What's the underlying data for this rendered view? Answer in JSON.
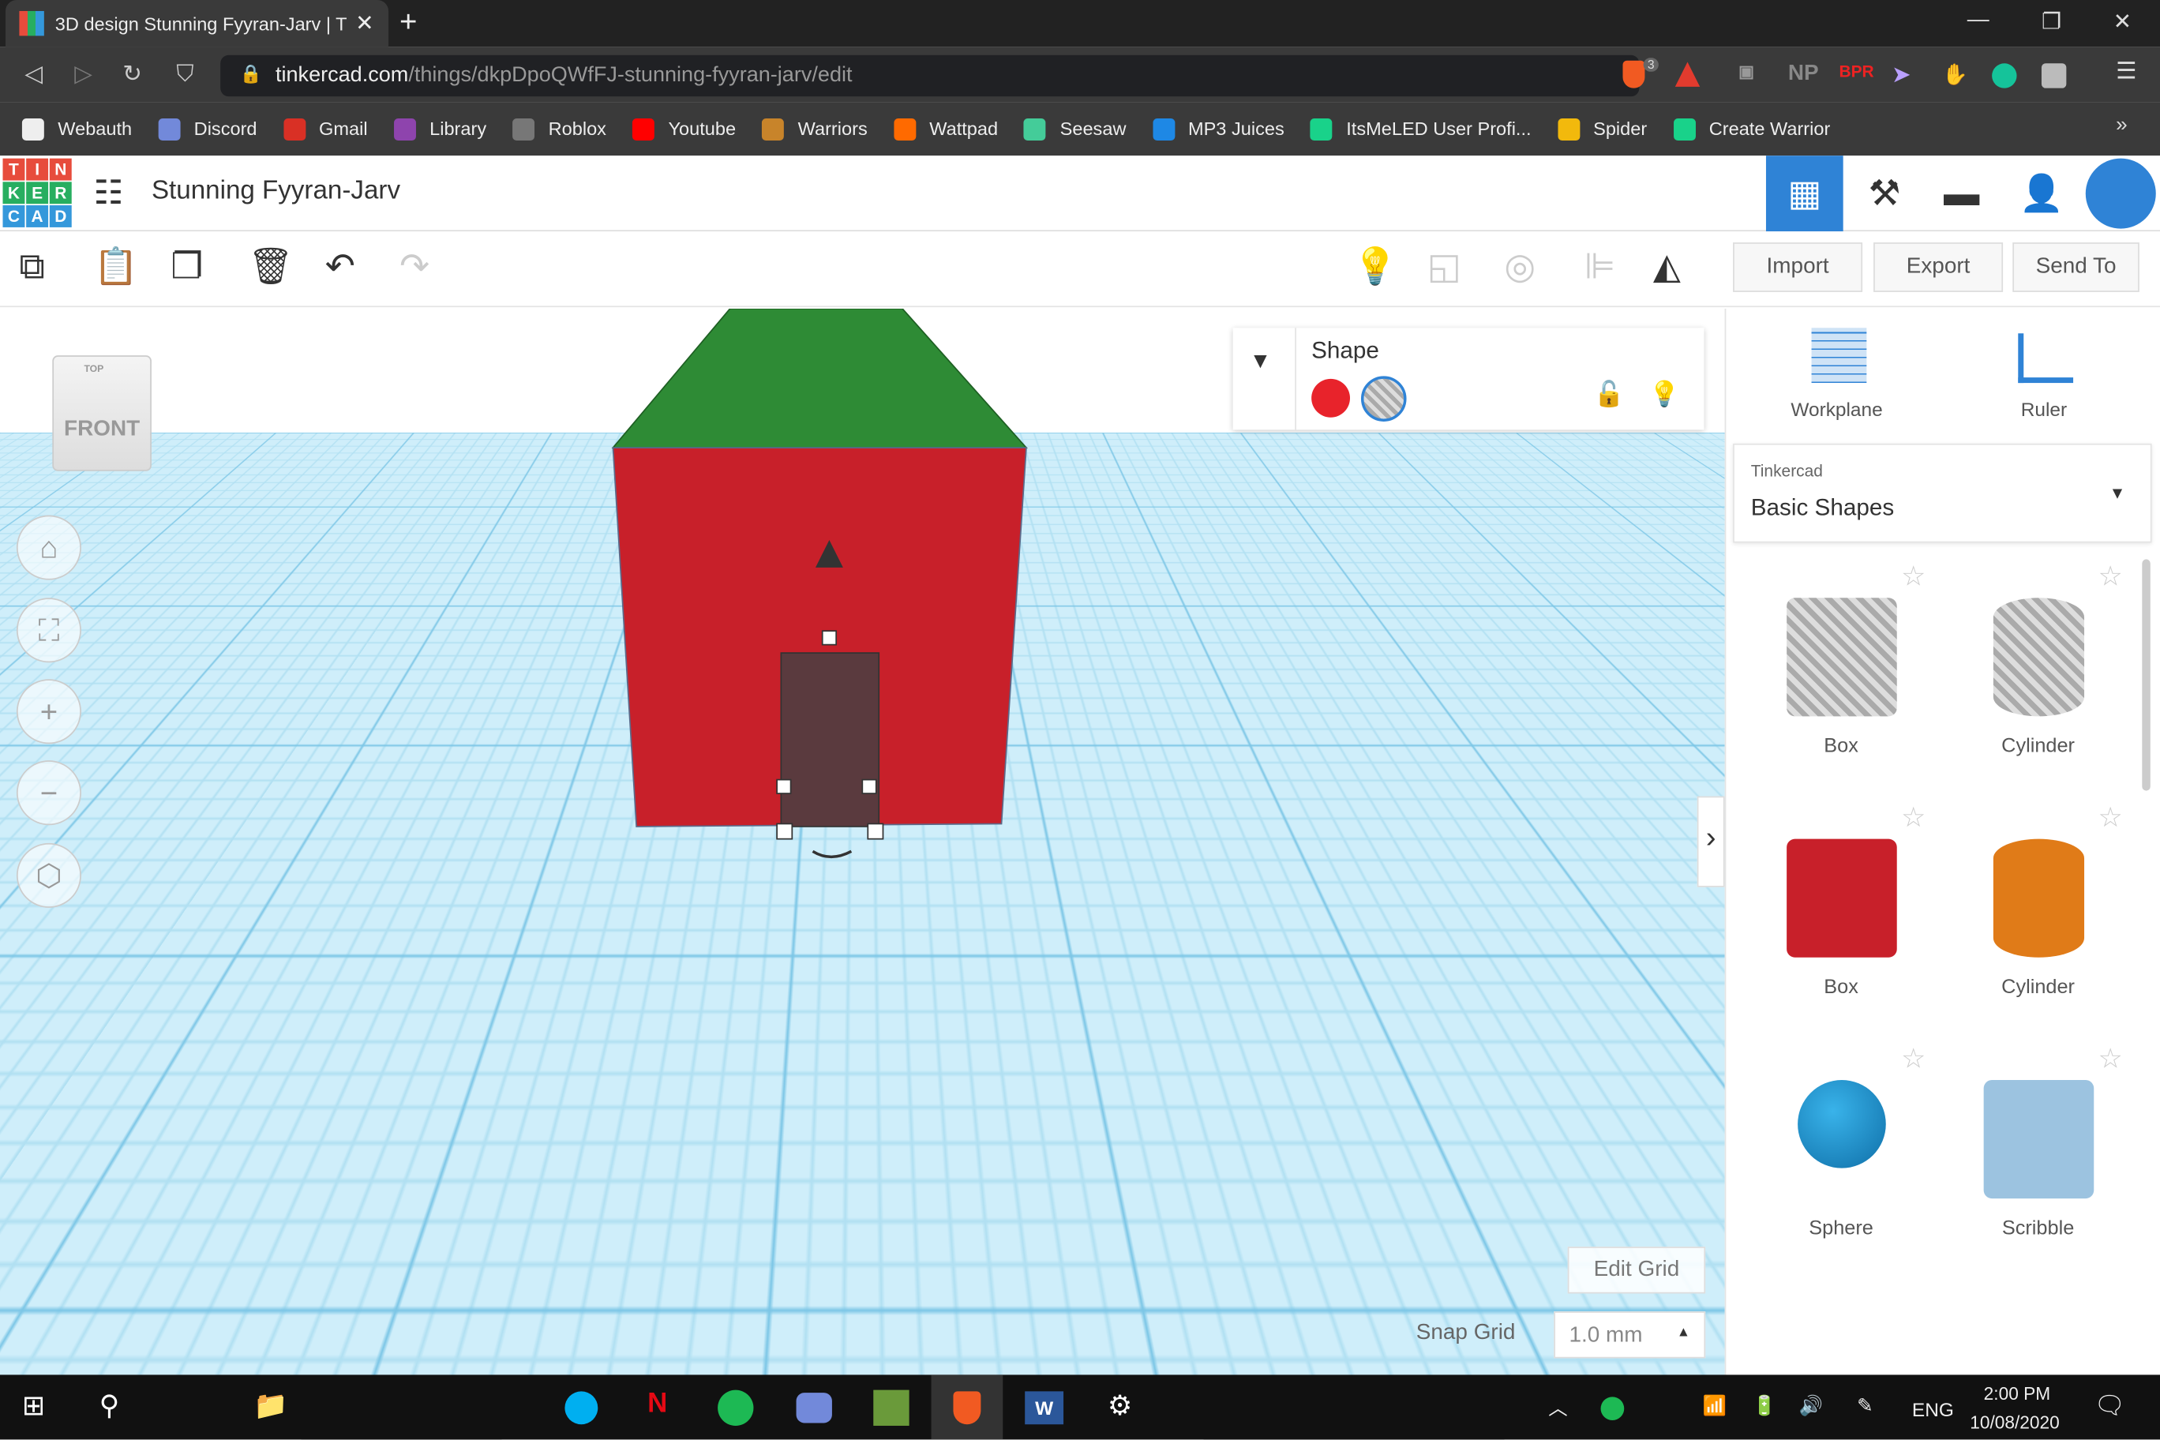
{
  "browser": {
    "tab_title": "3D design Stunning Fyyran-Jarv | T",
    "url_host": "tinkercad.com",
    "url_path": "/things/dkpDpoQWfFJ-stunning-fyyran-jarv/edit",
    "brave_badge": "3",
    "bookmarks": [
      {
        "label": "Webauth",
        "color": "#eeeeee"
      },
      {
        "label": "Discord",
        "color": "#7289da"
      },
      {
        "label": "Gmail",
        "color": "#d93025"
      },
      {
        "label": "Library",
        "color": "#8e44ad"
      },
      {
        "label": "Roblox",
        "color": "#777777"
      },
      {
        "label": "Youtube",
        "color": "#ff0000"
      },
      {
        "label": "Warriors",
        "color": "#c8842a"
      },
      {
        "label": "Wattpad",
        "color": "#ff6a00"
      },
      {
        "label": "Seesaw",
        "color": "#44cc99"
      },
      {
        "label": "MP3 Juices",
        "color": "#1e88e5"
      },
      {
        "label": "ItsMeLED User Profi...",
        "color": "#19d28a"
      },
      {
        "label": "Spider",
        "color": "#f2b90c"
      },
      {
        "label": "Create Warrior",
        "color": "#19d28a"
      }
    ],
    "more": "»"
  },
  "app": {
    "logo_letters": [
      "T",
      "I",
      "N",
      "K",
      "E",
      "R",
      "C",
      "A",
      "D"
    ],
    "design_title": "Stunning Fyyran-Jarv",
    "toolbar": {
      "import": "Import",
      "export": "Export",
      "send_to": "Send To"
    },
    "viewcube": {
      "top": "TOP",
      "front": "FRONT"
    },
    "shape_panel": {
      "title": "Shape",
      "solid_color": "#e8232b"
    },
    "right_panel": {
      "workplane": "Workplane",
      "ruler": "Ruler",
      "category_label": "Tinkercad",
      "category_value": "Basic Shapes",
      "shapes": [
        {
          "label": "Box",
          "style": "hole"
        },
        {
          "label": "Cylinder",
          "style": "hole"
        },
        {
          "label": "Box",
          "style": "red"
        },
        {
          "label": "Cylinder",
          "style": "orange"
        },
        {
          "label": "Sphere",
          "style": "blue"
        },
        {
          "label": "Scribble",
          "style": "scribble"
        }
      ]
    },
    "edit_grid": "Edit Grid",
    "snap_grid_label": "Snap Grid",
    "snap_grid_value": "1.0 mm",
    "colors": {
      "accent": "#2f83d6",
      "roof": "#2e8b35",
      "wall": "#c8202a",
      "door": "#5a3a3e"
    }
  },
  "taskbar": {
    "lang": "ENG",
    "time": "2:00 PM",
    "date": "10/08/2020"
  }
}
